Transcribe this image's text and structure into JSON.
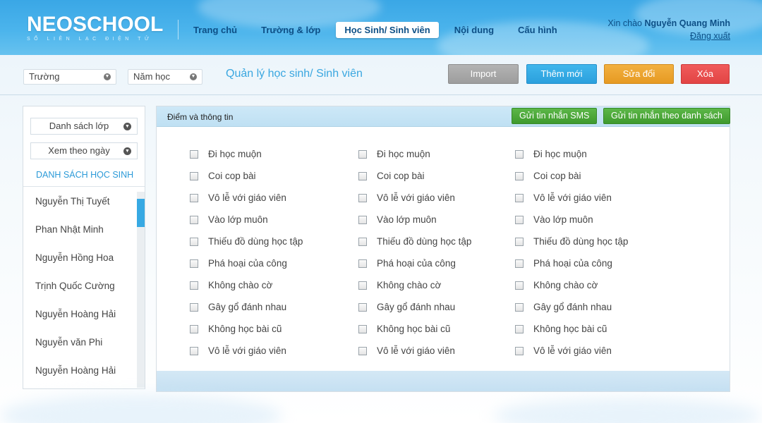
{
  "header": {
    "logo": "NEOSCHOOL",
    "logo_tagline": "SỔ LIÊN LẠC ĐIỆN TỬ",
    "nav": [
      {
        "label": "Trang chủ",
        "active": false
      },
      {
        "label": "Trường & lớp",
        "active": false
      },
      {
        "label": "Học Sinh/ Sinh viên",
        "active": true
      },
      {
        "label": "Nội dung",
        "active": false
      },
      {
        "label": "Cấu hình",
        "active": false
      }
    ],
    "greeting_prefix": "Xin chào",
    "user_name": "Nguyễn Quang Minh",
    "logout": "Đăng xuất"
  },
  "toolbar": {
    "school_select": "Trường",
    "year_select": "Năm học",
    "page_title": "Quản lý học sinh/ Sinh viên",
    "import_label": "Import",
    "add_label": "Thêm mới",
    "edit_label": "Sửa đổi",
    "delete_label": "Xóa"
  },
  "left_panel": {
    "class_list_select": "Danh sách lớp",
    "view_by_date_select": "Xem theo ngày",
    "heading": "DANH SÁCH HỌC SINH",
    "students": [
      "Nguyễn Thị Tuyết",
      "Phan Nhật Minh",
      "Nguyễn Hồng Hoa",
      "Trịnh Quốc Cường",
      "Nguyễn Hoàng Hải",
      "Nguyễn văn Phi",
      "Nguyễn Hoàng Hải"
    ]
  },
  "main_panel": {
    "title": "Điểm và thông tin",
    "sms_button": "Gửi tin nhắn SMS",
    "sms_list_button": "Gửi tin nhắn theo danh sách",
    "columns": [
      [
        "Đi học muộn",
        "Coi cop bài",
        "Vô lễ với giáo viên",
        "Vào lớp muôn",
        "Thiếu đồ dùng học tập",
        "Phá hoại của công",
        "Không chào cờ",
        "Gây gổ đánh nhau",
        "Không học bài cũ",
        "Vô lễ với giáo viên"
      ],
      [
        "Đi học muộn",
        "Coi cop bài",
        "Vô lễ với giáo viên",
        "Vào lớp muôn",
        "Thiếu đồ dùng học tập",
        "Phá hoại của công",
        "Không chào cờ",
        "Gây gổ đánh nhau",
        "Không học bài cũ",
        "Vô lễ với giáo viên"
      ],
      [
        "Đi học muộn",
        "Coi cop bài",
        "Vô lễ với giáo viên",
        "Vào lớp muôn",
        "Thiếu đồ dùng học tập",
        "Phá hoại của công",
        "Không chào cờ",
        "Gây gổ đánh nhau",
        "Không học bài cũ",
        "Vô lễ với giáo viên"
      ]
    ]
  },
  "colors": {
    "header_blue": "#3aa7e6",
    "nav_text": "#0d4f86",
    "import_gray": "#a8a8a8",
    "add_blue": "#2ba0dd",
    "edit_orange": "#e69a22",
    "delete_red": "#e24444",
    "sms_green": "#4aa83a",
    "accent_link": "#2b9ad8"
  }
}
